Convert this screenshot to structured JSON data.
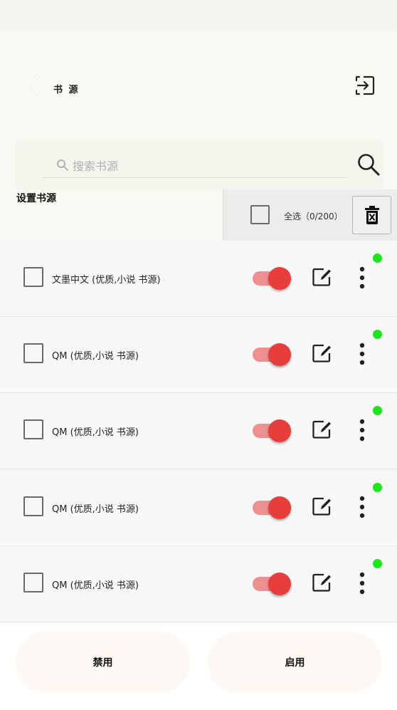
{
  "header": {
    "title": "书 源",
    "back_icon": "chevron-left-icon",
    "import_icon": "login-icon"
  },
  "search": {
    "placeholder": "搜索书源",
    "value": "",
    "icon": "search-icon"
  },
  "section": {
    "label": "设置书源"
  },
  "selection": {
    "select_all_label": "全选（0/200）",
    "selected": 0,
    "total": 200,
    "delete_icon": "trash-icon"
  },
  "sources": [
    {
      "name": "文墨中文 (优质,小说 书源)",
      "enabled": true,
      "checked": false,
      "status": "online"
    },
    {
      "name": "QM (优质,小说 书源)",
      "enabled": true,
      "checked": false,
      "status": "online"
    },
    {
      "name": "QM (优质,小说 书源)",
      "enabled": true,
      "checked": false,
      "status": "online"
    },
    {
      "name": "QM (优质,小说 书源)",
      "enabled": true,
      "checked": false,
      "status": "online"
    },
    {
      "name": "QM (优质,小说 书源)",
      "enabled": true,
      "checked": false,
      "status": "online"
    }
  ],
  "footer": {
    "disable_label": "禁用",
    "enable_label": "启用"
  },
  "colors": {
    "toggle_on": "#e83d3d",
    "toggle_track": "#ef9090",
    "status_online": "#1de41d",
    "background": "#f7f7f7",
    "bottom_button": "#fdf8f3"
  }
}
